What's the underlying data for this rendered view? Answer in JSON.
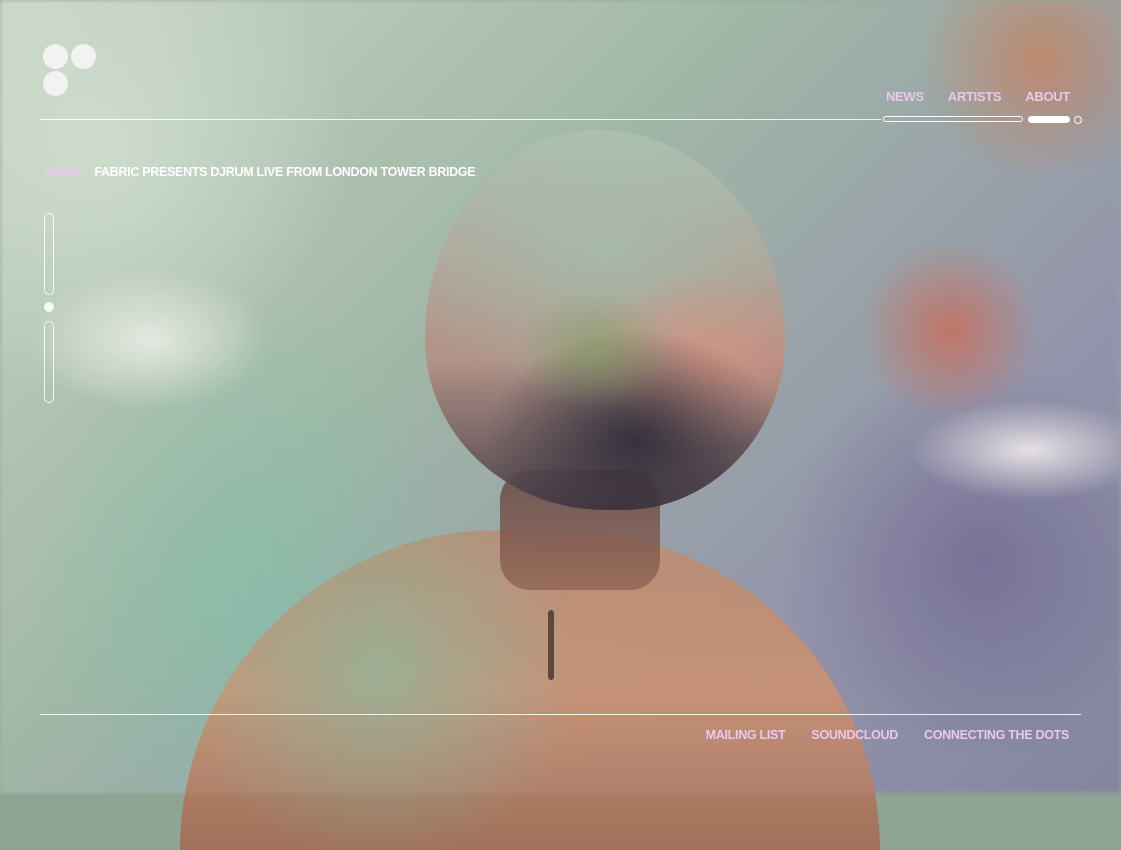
{
  "brand": {
    "logo": "fabric-dots-logo"
  },
  "nav": {
    "items": [
      {
        "label": "NEWS"
      },
      {
        "label": "ARTISTS"
      },
      {
        "label": "ABOUT"
      }
    ]
  },
  "breadcrumb": {
    "section": "NEWS",
    "title": "FABRIC PRESENTS DJRUM LIVE FROM LONDON TOWER BRIDGE"
  },
  "footer": {
    "links": [
      {
        "label": "MAILING LIST"
      },
      {
        "label": "SOUNDCLOUD"
      },
      {
        "label": "CONNECTING THE DOTS"
      }
    ]
  },
  "colors": {
    "accent": "#e9c8ee",
    "text_light": "#ffffff"
  }
}
